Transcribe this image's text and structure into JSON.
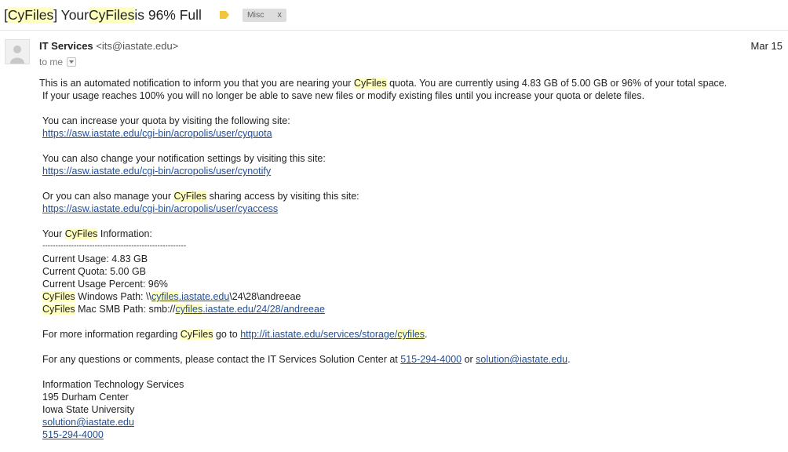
{
  "subject": {
    "open_bracket": "[",
    "tag": "CyFiles",
    "close_bracket": "] Your ",
    "product": "CyFiles",
    "rest": " is 96% Full"
  },
  "label_chip": {
    "text": "Misc",
    "remove": "x"
  },
  "sender": {
    "name": "IT Services",
    "email": "<its@iastate.edu>"
  },
  "date": "Mar 15",
  "recipient": "to me",
  "body": {
    "intro_a": "This is an automated notification to inform you that you are nearing your ",
    "intro_hl": "CyFiles",
    "intro_b": " quota. You are currently using 4.83 GB of 5.00 GB or 96% of your total space.",
    "intro_line2": "If your usage reaches 100% you will no longer be able to save new files or modify existing files until you increase your quota or delete files.",
    "quota_text": "You can increase your quota by visiting the following site:",
    "quota_link": "https://asw.iastate.edu/cgi-bin/acropolis/user/cyquota",
    "notify_text": "You can also change your notification settings by visiting this site:",
    "notify_link": "https://asw.iastate.edu/cgi-bin/acropolis/user/cynotify",
    "access_a": "Or you can also manage your ",
    "access_hl": "CyFiles",
    "access_b": " sharing access by visiting this site:",
    "access_link": "https://asw.iastate.edu/cgi-bin/acropolis/user/cyaccess",
    "info_a": "Your ",
    "info_hl": "CyFiles",
    "info_b": " Information:",
    "separator": "-------------------------------------------------------",
    "usage": "Current Usage: 4.83 GB",
    "quota": "Current Quota: 5.00 GB",
    "percent": "Current Usage Percent: 96%",
    "win_hl": "CyFiles",
    "win_a": " Windows Path: \\\\",
    "win_link_hl": "cyfiles",
    "win_link_rest": ".iastate.edu",
    "win_tail": "\\24\\28\\andreeae",
    "mac_hl": "CyFiles",
    "mac_a": " Mac SMB Path: smb://",
    "mac_link_hl": "cyfiles",
    "mac_link_rest": ".iastate.edu/24/28/andreeae",
    "more_a": "For more information regarding ",
    "more_hl": "CyFiles",
    "more_b": " go to ",
    "more_link_a": "http://it.iastate.edu/services/storage/",
    "more_link_hl": "cyfiles",
    "more_end": ".",
    "questions_a": "For any questions or comments, please contact the IT Services Solution Center at ",
    "questions_phone": "515-294-4000",
    "questions_or": " or ",
    "questions_email": "solution@iastate.edu",
    "questions_end": ".",
    "sig_org": "Information Technology Services",
    "sig_addr": "195 Durham Center",
    "sig_uni": "Iowa State University",
    "sig_email": "solution@iastate.edu",
    "sig_phone": "515-294-4000"
  },
  "colors": {
    "highlight": "#ffffc0",
    "link": "#1f4e9c",
    "label_marker": "#f2c63c",
    "chip_bg": "#dddddd"
  },
  "icons": {
    "label": "label-tag-icon",
    "avatar": "default-avatar-icon",
    "dropdown": "chevron-down-icon"
  }
}
